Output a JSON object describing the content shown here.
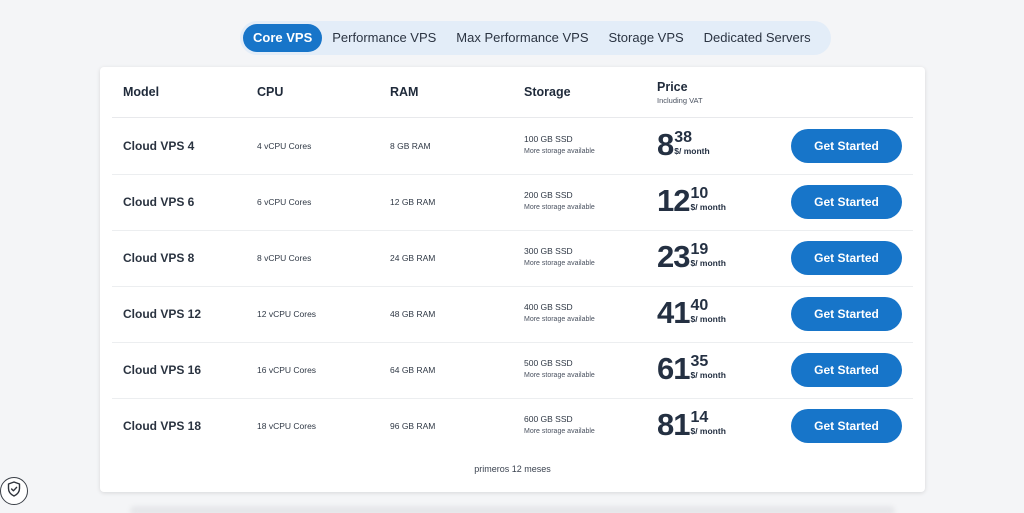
{
  "tabs": [
    {
      "label": "Core VPS",
      "active": true
    },
    {
      "label": "Performance VPS",
      "active": false
    },
    {
      "label": "Max Performance VPS",
      "active": false
    },
    {
      "label": "Storage VPS",
      "active": false
    },
    {
      "label": "Dedicated Servers",
      "active": false
    }
  ],
  "table": {
    "headers": {
      "model": "Model",
      "cpu": "CPU",
      "ram": "RAM",
      "storage": "Storage",
      "price": "Price",
      "price_sub": "Including VAT"
    },
    "rows": [
      {
        "model": "Cloud VPS 4",
        "cpu": "4 vCPU Cores",
        "ram": "8 GB RAM",
        "storage": "100 GB SSD",
        "storage_note": "More storage available",
        "price_int": "8",
        "price_dec": "38",
        "price_unit": "$/ month",
        "cta": "Get Started"
      },
      {
        "model": "Cloud VPS 6",
        "cpu": "6 vCPU Cores",
        "ram": "12 GB RAM",
        "storage": "200 GB SSD",
        "storage_note": "More storage available",
        "price_int": "12",
        "price_dec": "10",
        "price_unit": "$/ month",
        "cta": "Get Started"
      },
      {
        "model": "Cloud VPS 8",
        "cpu": "8 vCPU Cores",
        "ram": "24 GB RAM",
        "storage": "300 GB SSD",
        "storage_note": "More storage available",
        "price_int": "23",
        "price_dec": "19",
        "price_unit": "$/ month",
        "cta": "Get Started"
      },
      {
        "model": "Cloud VPS 12",
        "cpu": "12 vCPU Cores",
        "ram": "48 GB RAM",
        "storage": "400 GB SSD",
        "storage_note": "More storage available",
        "price_int": "41",
        "price_dec": "40",
        "price_unit": "$/ month",
        "cta": "Get Started"
      },
      {
        "model": "Cloud VPS 16",
        "cpu": "16 vCPU Cores",
        "ram": "64 GB RAM",
        "storage": "500 GB SSD",
        "storage_note": "More storage available",
        "price_int": "61",
        "price_dec": "35",
        "price_unit": "$/ month",
        "cta": "Get Started"
      },
      {
        "model": "Cloud VPS 18",
        "cpu": "18 vCPU Cores",
        "ram": "96 GB RAM",
        "storage": "600 GB SSD",
        "storage_note": "More storage available",
        "price_int": "81",
        "price_dec": "14",
        "price_unit": "$/ month",
        "cta": "Get Started"
      }
    ],
    "footnote": "primeros 12 meses"
  },
  "icons": {
    "privacy": "shield-check-icon"
  },
  "colors": {
    "accent": "#1775c9",
    "tabs_bg": "#e3edf8",
    "page_bg": "#f4f5f7"
  }
}
